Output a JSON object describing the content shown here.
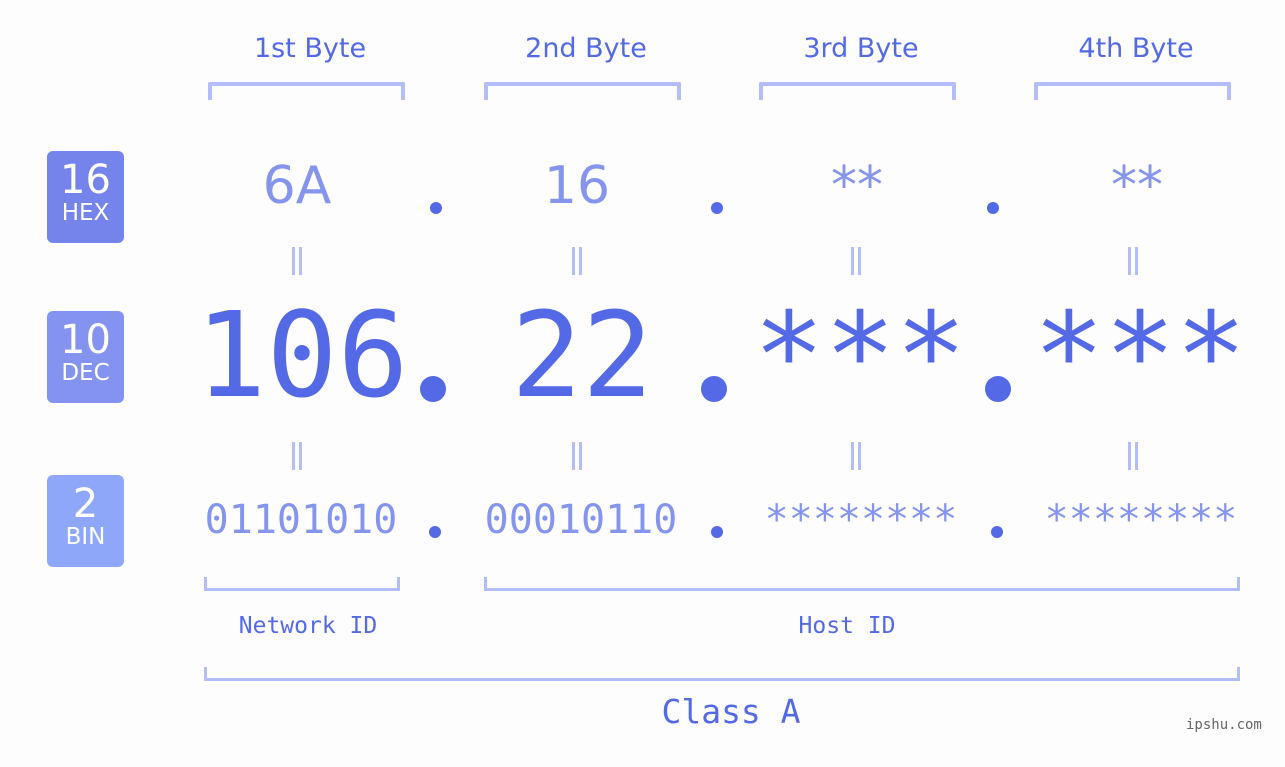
{
  "colors": {
    "accent": "#5369e6",
    "light_value": "#8594ec",
    "bracket": "#b3bdf7",
    "hex_badge": "#7584ea",
    "dec_badge": "#8393ef",
    "bin_badge": "#8fa7f8",
    "background": "#fcfdfc"
  },
  "bytes": [
    {
      "header": "1st Byte",
      "hex": "6A",
      "dec": "106",
      "bin": "01101010"
    },
    {
      "header": "2nd Byte",
      "hex": "16",
      "dec": "22",
      "bin": "00010110"
    },
    {
      "header": "3rd Byte",
      "hex": "**",
      "dec": "***",
      "bin": "********"
    },
    {
      "header": "4th Byte",
      "hex": "**",
      "dec": "***",
      "bin": "********"
    }
  ],
  "badges": {
    "hex": {
      "number": "16",
      "label": "HEX"
    },
    "dec": {
      "number": "10",
      "label": "DEC"
    },
    "bin": {
      "number": "2",
      "label": "BIN"
    }
  },
  "network_id_label": "Network ID",
  "host_id_label": "Host ID",
  "class_label": "Class A",
  "watermark": "ipshu.com"
}
